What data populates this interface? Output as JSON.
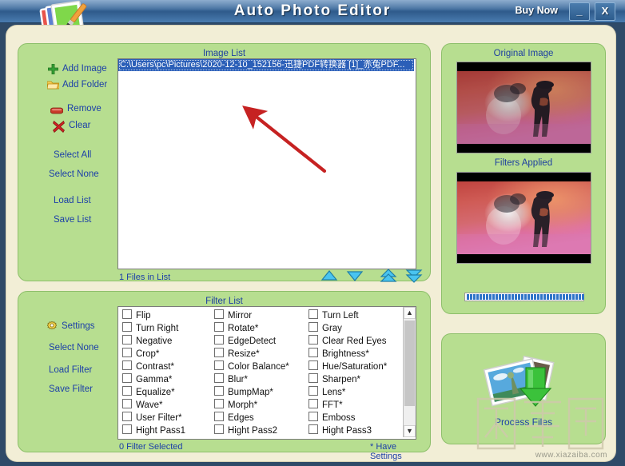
{
  "window": {
    "title": "Auto Photo Editor",
    "buy_now": "Buy Now",
    "minimize": "_",
    "close": "X",
    "app_icon": "photo-brush-icon"
  },
  "image_list": {
    "title": "Image List",
    "selected_path": "C:\\Users\\pc\\Pictures\\2020-12-10_152156-迅捷PDF转换器 [1]_赤兔PDF...",
    "files_count": "1 Files in List",
    "sidebar": [
      {
        "label": "Add Image",
        "icon": "plus-icon"
      },
      {
        "label": "Add Folder",
        "icon": "folder-icon"
      },
      {
        "label": "Remove",
        "icon": "minus-icon"
      },
      {
        "label": "Clear",
        "icon": "x-mark-icon"
      },
      {
        "label": "Select All",
        "icon": ""
      },
      {
        "label": "Select None",
        "icon": ""
      },
      {
        "label": "Load List",
        "icon": ""
      },
      {
        "label": "Save List",
        "icon": ""
      }
    ],
    "nav_buttons": [
      {
        "name": "move-up-icon"
      },
      {
        "name": "move-down-icon"
      },
      {
        "name": "move-top-icon"
      },
      {
        "name": "move-bottom-icon"
      }
    ]
  },
  "filter_list": {
    "title": "Filter List",
    "status": "0 Filter Selected",
    "legend": "* Have Settings",
    "sidebar": [
      {
        "label": "Settings",
        "icon": "gear-icon"
      },
      {
        "label": "Select None",
        "icon": ""
      },
      {
        "label": "Load Filter",
        "icon": ""
      },
      {
        "label": "Save Filter",
        "icon": ""
      }
    ],
    "columns": [
      [
        "Flip",
        "Turn Right",
        "Negative",
        "Crop*",
        "Contrast*",
        "Gamma*",
        "Equalize*",
        "Wave*",
        "User Filter*",
        "Hight Pass1"
      ],
      [
        "Mirror",
        "Rotate*",
        "EdgeDetect",
        "Resize*",
        "Color Balance*",
        "Blur*",
        "BumpMap*",
        "Morph*",
        "Edges",
        "Hight Pass2"
      ],
      [
        "Turn Left",
        "Gray",
        "Clear Red Eyes",
        "Brightness*",
        "Hue/Saturation*",
        "Sharpen*",
        "Lens*",
        "FFT*",
        "Emboss",
        "Hight Pass3"
      ]
    ]
  },
  "preview": {
    "original_title": "Original Image",
    "filtered_title": "Filters Applied",
    "progress_segments": 37
  },
  "process": {
    "label": "Process Files",
    "icon": "photos-download-icon"
  },
  "watermark": {
    "text": "下载吧",
    "url": "www.xiazaiba.com"
  },
  "colors": {
    "titlebar": "#3f6d9e",
    "panel_green": "#b7de90",
    "canvas_beige": "#f2eed6",
    "link_blue": "#1c3fa8",
    "selection_blue": "#2b5fb8",
    "annotation_red": "#c62222"
  }
}
